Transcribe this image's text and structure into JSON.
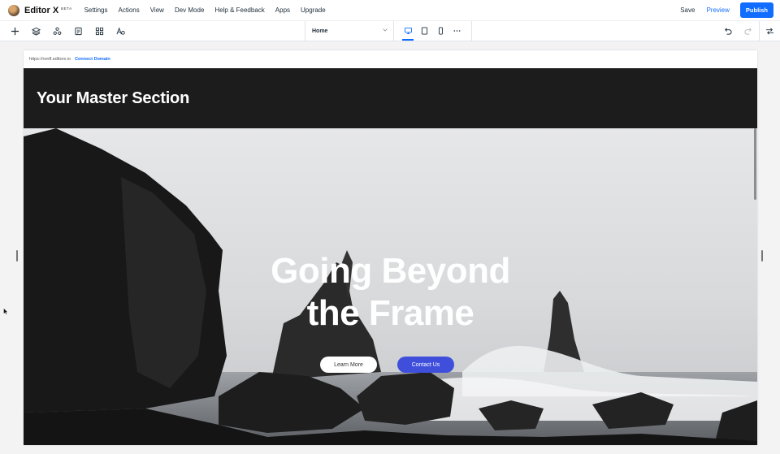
{
  "app": {
    "brand": "Editor X",
    "beta": "BETA",
    "menu": [
      "Settings",
      "Actions",
      "View",
      "Dev Mode",
      "Help & Feedback",
      "Apps",
      "Upgrade"
    ],
    "save_label": "Save",
    "preview_label": "Preview",
    "publish_label": "Publish"
  },
  "toolbar": {
    "page_select": "Home",
    "icons_left": [
      "add-icon",
      "layers-icon",
      "components-icon",
      "pages-icon",
      "grid-icon",
      "text-style-icon"
    ],
    "devices": [
      "desktop-icon",
      "tablet-icon",
      "mobile-icon"
    ],
    "active_device": "desktop-icon",
    "icons_right": [
      "undo-icon",
      "redo-icon",
      "settings-toggle-icon"
    ]
  },
  "site": {
    "url": "https://ronfl.editorx.io",
    "connect_domain": "Connect Domain",
    "master_title": "Your Master Section",
    "hero_title_line1": "Going Beyond",
    "hero_title_line2": "the Frame",
    "learn_more": "Learn More",
    "contact_us": "Contact Us"
  },
  "colors": {
    "accent": "#116dff",
    "master_bg": "#1c1c1c",
    "contact_btn": "#3f4fdc"
  }
}
